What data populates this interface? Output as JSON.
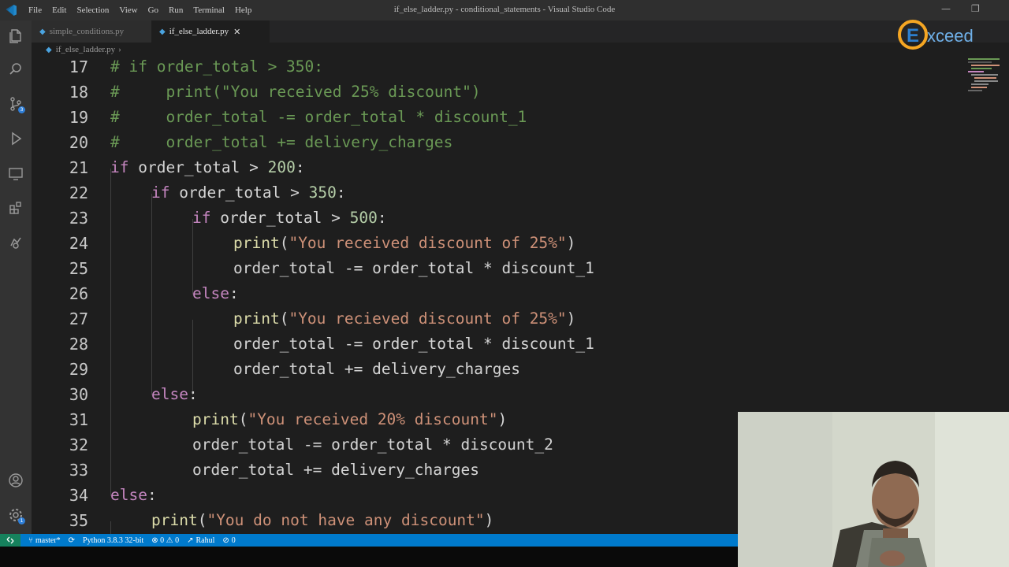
{
  "titlebar": {
    "menu": [
      "File",
      "Edit",
      "Selection",
      "View",
      "Go",
      "Run",
      "Terminal",
      "Help"
    ],
    "window_title": "if_else_ladder.py - conditional_statements - Visual Studio Code"
  },
  "tabs": [
    {
      "label": "simple_conditions.py",
      "active": false
    },
    {
      "label": "if_else_ladder.py",
      "active": true
    }
  ],
  "breadcrumb": {
    "file": "if_else_ladder.py",
    "separator": "›"
  },
  "logo": {
    "text": "xceed"
  },
  "editor": {
    "lines": [
      {
        "n": "17"
      },
      {
        "n": "18"
      },
      {
        "n": "19"
      },
      {
        "n": "20"
      },
      {
        "n": "21"
      },
      {
        "n": "22"
      },
      {
        "n": "23"
      },
      {
        "n": "24"
      },
      {
        "n": "25"
      },
      {
        "n": "26"
      },
      {
        "n": "27"
      },
      {
        "n": "28"
      },
      {
        "n": "29"
      },
      {
        "n": "30"
      },
      {
        "n": "31"
      },
      {
        "n": "32"
      },
      {
        "n": "33"
      },
      {
        "n": "34"
      },
      {
        "n": "35"
      }
    ],
    "code": {
      "l17": "# if order_total > 350:",
      "l18": "#     print(\"You received 25% discount\")",
      "l19": "#     order_total -= order_total * discount_1",
      "l20": "#     order_total += delivery_charges",
      "l21_kw": "if",
      "l21_rest": " order_total > ",
      "l21_num": "200",
      "l21_end": ":",
      "l22_kw": "if",
      "l22_rest": " order_total > ",
      "l22_num": "350",
      "l22_end": ":",
      "l23_kw": "if",
      "l23_rest": " order_total > ",
      "l23_num": "500",
      "l23_end": ":",
      "l24_fn": "print",
      "l24_str": "\"You received discount of 25%\"",
      "l25": "order_total -= order_total * discount_1",
      "l26_kw": "else",
      "l26_end": ":",
      "l27_fn": "print",
      "l27_str": "\"You recieved discount of 25%\"",
      "l28": "order_total -= order_total * discount_1",
      "l29": "order_total += delivery_charges",
      "l30_kw": "else",
      "l30_end": ":",
      "l31_fn": "print",
      "l31_str": "\"You received 20% discount\"",
      "l32": "order_total -= order_total * discount_2",
      "l33": "order_total += delivery_charges",
      "l34_kw": "else",
      "l34_end": ":",
      "l35_fn": "print",
      "l35_str": "\"You do not have any discount\""
    }
  },
  "statusbar": {
    "branch": "master*",
    "python": "Python 3.8.3 32-bit",
    "problems": "⊗ 0 ⚠ 0",
    "user": "Rahul",
    "extra": "0"
  },
  "colors": {
    "keyword": "#c586c0",
    "string": "#ce9178",
    "comment": "#6a9955",
    "statusbar": "#007acc"
  }
}
